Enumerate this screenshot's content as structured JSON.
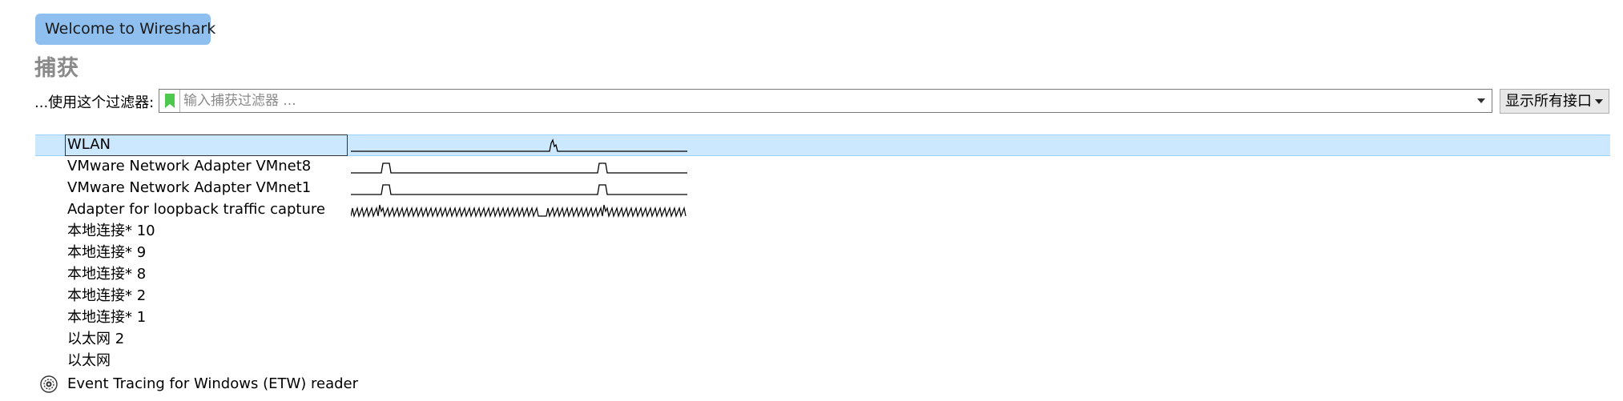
{
  "welcome": {
    "label": "Welcome to Wireshark"
  },
  "capture": {
    "heading": "捕获",
    "filter_label": "...使用这个过滤器:",
    "filter_placeholder": "输入捕获过滤器 ...",
    "filter_value": "",
    "show_all_label": "显示所有接口"
  },
  "interfaces": [
    {
      "name": "WLAN",
      "selected": true,
      "sparkline": "wlan"
    },
    {
      "name": "VMware Network Adapter VMnet8",
      "selected": false,
      "sparkline": "vmnet"
    },
    {
      "name": "VMware Network Adapter VMnet1",
      "selected": false,
      "sparkline": "vmnet"
    },
    {
      "name": "Adapter for loopback traffic capture",
      "selected": false,
      "sparkline": "loopback"
    },
    {
      "name": "本地连接* 10",
      "selected": false,
      "sparkline": null
    },
    {
      "name": "本地连接* 9",
      "selected": false,
      "sparkline": null
    },
    {
      "name": "本地连接* 8",
      "selected": false,
      "sparkline": null
    },
    {
      "name": "本地连接* 2",
      "selected": false,
      "sparkline": null
    },
    {
      "name": "本地连接* 1",
      "selected": false,
      "sparkline": null
    },
    {
      "name": "以太网 2",
      "selected": false,
      "sparkline": null
    },
    {
      "name": "以太网",
      "selected": false,
      "sparkline": null
    },
    {
      "name": "Event Tracing for Windows (ETW) reader",
      "selected": false,
      "sparkline": null,
      "icon": "gear-icon"
    }
  ],
  "colors": {
    "welcome_bg": "#8ebfee",
    "selection_bg": "#cce8ff",
    "bookmark_green": "#4ec94e",
    "heading_gray": "#8a8a8a"
  }
}
